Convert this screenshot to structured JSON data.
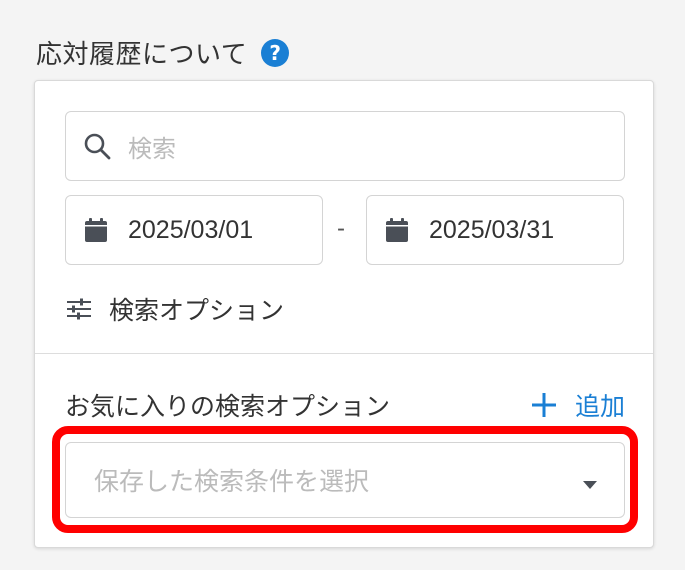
{
  "header": {
    "title": "応対履歴について",
    "help_icon": "?"
  },
  "search": {
    "placeholder": "検索"
  },
  "date_range": {
    "start": "2025/03/01",
    "separator": "-",
    "end": "2025/03/31"
  },
  "search_options": {
    "label": "検索オプション"
  },
  "favorites": {
    "label": "お気に入りの検索オプション",
    "add_label": "追加",
    "select_placeholder": "保存した検索条件を選択"
  },
  "colors": {
    "accent": "#1a7fd4",
    "highlight": "#ff0000",
    "icon": "#4a4f57",
    "placeholder": "#bbbbbb"
  },
  "icons": [
    "help-icon",
    "search-icon",
    "calendar-icon",
    "sliders-icon",
    "plus-icon",
    "caret-down-icon"
  ]
}
